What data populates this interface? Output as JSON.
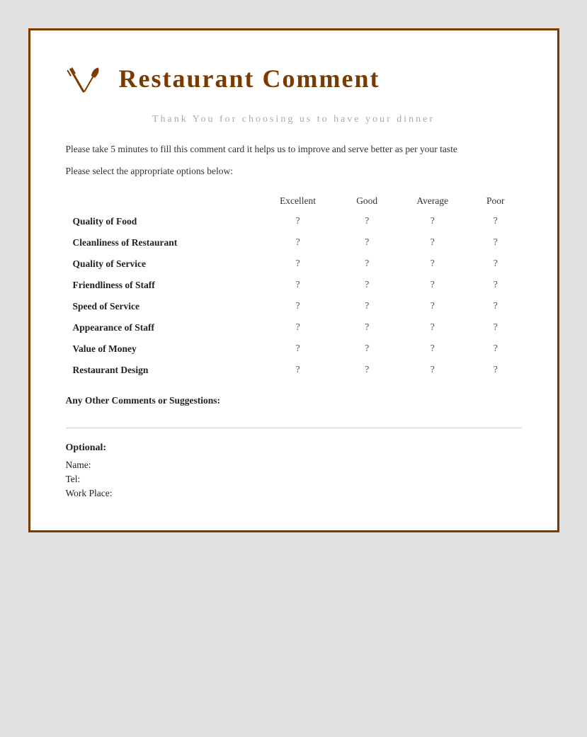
{
  "header": {
    "title": "Restaurant Comment"
  },
  "tagline": "Thank You for choosing us to have your\ndinner",
  "body": {
    "intro": "Please take 5 minutes to fill this comment card it helps us to improve and serve better as per your taste",
    "instruction": "Please select the appropriate options below:"
  },
  "table": {
    "columns": [
      "",
      "Excellent",
      "Good",
      "Average",
      "Poor"
    ],
    "rows": [
      {
        "label": "Quality of Food",
        "values": [
          "?",
          "?",
          "?",
          "?"
        ]
      },
      {
        "label": "Cleanliness of Restaurant",
        "values": [
          "?",
          "?",
          "?",
          "?"
        ]
      },
      {
        "label": "Quality of Service",
        "values": [
          "?",
          "?",
          "?",
          "?"
        ]
      },
      {
        "label": "Friendliness of Staff",
        "values": [
          "?",
          "?",
          "?",
          "?"
        ]
      },
      {
        "label": "Speed of Service",
        "values": [
          "?",
          "?",
          "?",
          "?"
        ]
      },
      {
        "label": "Appearance of Staff",
        "values": [
          "?",
          "?",
          "?",
          "?"
        ]
      },
      {
        "label": "Value of Money",
        "values": [
          "?",
          "?",
          "?",
          "?"
        ]
      },
      {
        "label": "Restaurant Design",
        "values": [
          "?",
          "?",
          "?",
          "?"
        ]
      }
    ]
  },
  "comments": {
    "label": "Any Other Comments or Suggestions:"
  },
  "optional": {
    "title": "Optional:",
    "fields": [
      "Name:",
      "Tel:",
      "Work Place:"
    ]
  }
}
